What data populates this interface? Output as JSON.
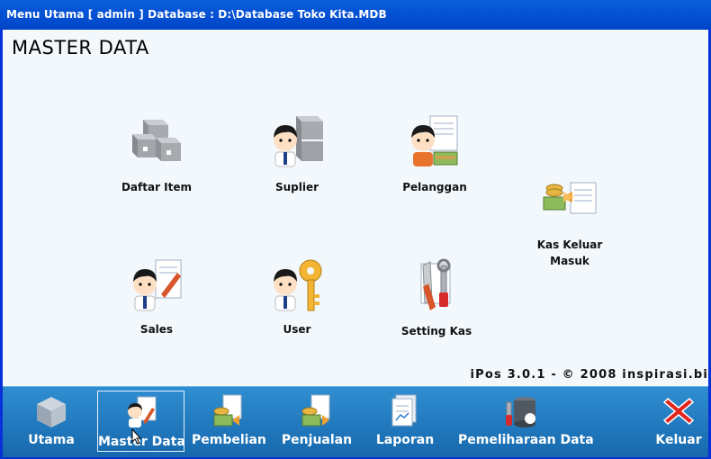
{
  "window": {
    "title": "Menu Utama [ admin ] Database : D:\\Database Toko Kita.MDB"
  },
  "main": {
    "heading": "MASTER DATA",
    "items": [
      {
        "label": "Daftar Item",
        "icon": "boxes-icon"
      },
      {
        "label": "Suplier",
        "icon": "supplier-icon"
      },
      {
        "label": "Pelanggan",
        "icon": "customer-icon"
      },
      {
        "label": "Kas Keluar Masuk",
        "icon": "cash-transfer-icon"
      },
      {
        "label": "Sales",
        "icon": "sales-icon"
      },
      {
        "label": "User",
        "icon": "user-key-icon"
      },
      {
        "label": "Setting Kas",
        "icon": "tools-icon"
      }
    ],
    "version": "iPos 3.0.1 - © 2008 inspirasi.bi"
  },
  "nav": {
    "items": [
      {
        "label": "Utama",
        "icon": "building-icon"
      },
      {
        "label": "Master Data",
        "icon": "master-data-icon",
        "active": true
      },
      {
        "label": "Pembelian",
        "icon": "purchase-icon"
      },
      {
        "label": "Penjualan",
        "icon": "sales-transaction-icon"
      },
      {
        "label": "Laporan",
        "icon": "report-icon"
      },
      {
        "label": "Pemeliharaan Data",
        "icon": "maintenance-icon"
      },
      {
        "label": "Keluar",
        "icon": "exit-icon"
      }
    ]
  },
  "colors": {
    "titlebar": "#0553d6",
    "background": "#f3f8fc",
    "navbar": "#1f7cc0",
    "exit": "#e0261e"
  }
}
